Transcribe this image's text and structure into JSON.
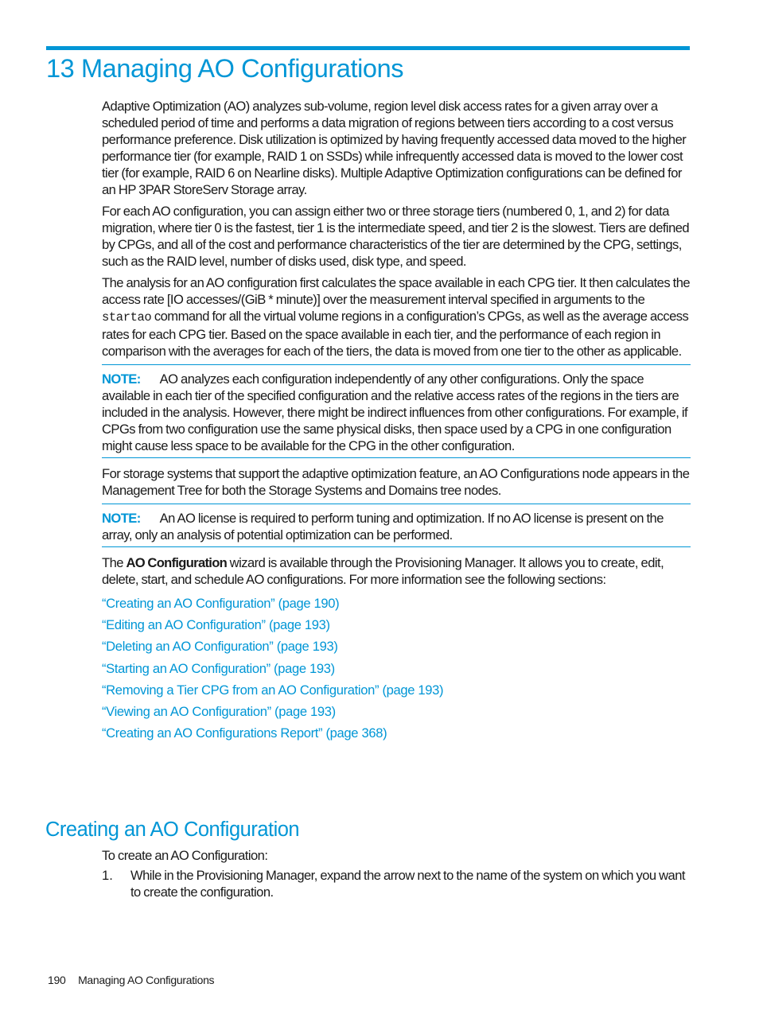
{
  "chapter": {
    "title": "13 Managing AO Configurations"
  },
  "paragraphs": {
    "intro": "Adaptive Optimization (AO) analyzes sub-volume, region level disk access rates for a given array over a scheduled period of time and performs a data migration of regions between tiers according to a cost versus performance preference. Disk utilization is optimized by having frequently accessed data moved to the higher performance tier (for example, RAID 1 on SSDs) while infrequently accessed data is moved to the lower cost tier (for example, RAID 6 on Nearline disks). Multiple Adaptive Optimization configurations can be defined for an HP 3PAR StoreServ Storage array.",
    "tiers": "For each AO configuration, you can assign either two or three storage tiers (numbered 0, 1, and 2) for data migration, where tier 0 is the fastest, tier 1 is the intermediate speed, and tier 2 is the slowest. Tiers are defined by CPGs, and all of the cost and performance characteristics of the tier are determined by the CPG, settings, such as the RAID level, number of disks used, disk type, and speed.",
    "analysis_before": "The analysis for an AO configuration first calculates the space available in each CPG tier. It then calculates the access rate [IO accesses/(GiB * minute)] over the measurement interval specified in arguments to the ",
    "analysis_code": "startao",
    "analysis_after": " command for all the virtual volume regions in a configuration’s CPGs, as well as the average access rates for each CPG tier. Based on the space available in each tier, and the performance of each region in comparison with the averages for each of the tiers, the data is moved from one tier to the other as applicable.",
    "storage_systems": "For storage systems that support the adaptive optimization feature, an AO Configurations node appears in the Management Tree for both the Storage Systems and Domains tree nodes.",
    "wizard_before": "The ",
    "wizard_bold": "AO Configuration",
    "wizard_after": " wizard is available through the Provisioning Manager. It allows you to create, edit, delete, start, and schedule AO configurations. For more information see the following sections:"
  },
  "notes": [
    {
      "label": "NOTE:",
      "text": "AO analyzes each configuration independently of any other configurations. Only the space available in each tier of the specified configuration and the relative access rates of the regions in the tiers are included in the analysis. However, there might be indirect influences from other configurations. For example, if CPGs from two configuration use the same physical disks, then space used by a CPG in one configuration might cause less space to be available for the CPG in the other configuration."
    },
    {
      "label": "NOTE:",
      "text": "An AO license is required to perform tuning and optimization. If no AO license is present on the array, only an analysis of potential optimization can be performed."
    }
  ],
  "links": [
    "“Creating an AO Configuration” (page 190)",
    "“Editing an AO Configuration” (page 193)",
    "“Deleting an AO Configuration” (page 193)",
    "“Starting an AO Configuration” (page 193)",
    "“Removing a Tier CPG from an AO Configuration” (page 193)",
    "“Viewing an AO Configuration” (page 193)",
    "“Creating an AO Configurations Report” (page 368)"
  ],
  "section": {
    "title": "Creating an AO Configuration",
    "intro": "To create an AO Configuration:",
    "steps": [
      {
        "number": "1.",
        "text": "While in the Provisioning Manager, expand the arrow next to the name of the system on which you want to create the configuration."
      }
    ]
  },
  "footer": {
    "page_number": "190",
    "chapter_name": "Managing AO Configurations"
  },
  "colors": {
    "accent": "#0096d6",
    "text": "#1a1a1a"
  }
}
